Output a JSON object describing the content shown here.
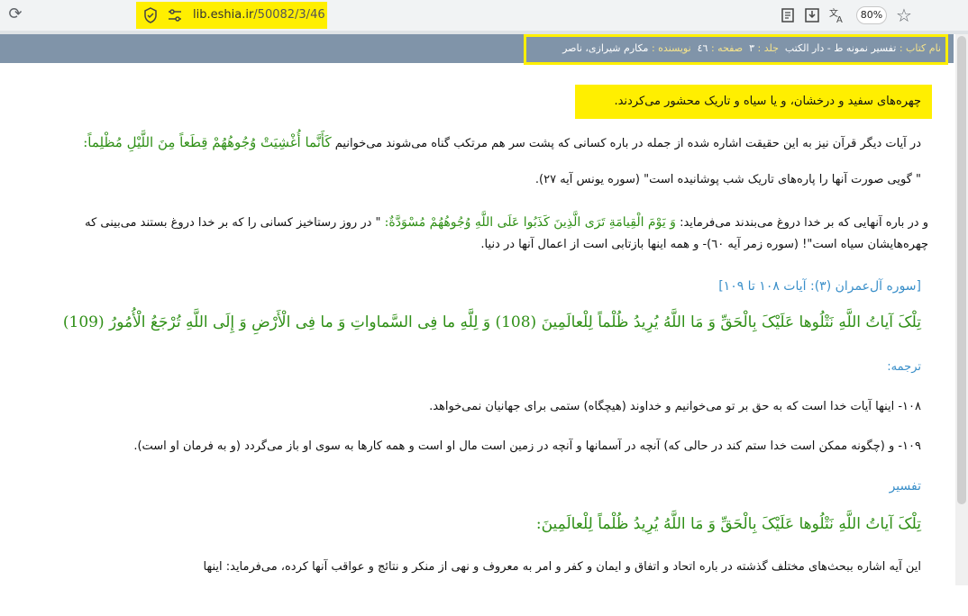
{
  "browser": {
    "url_domain": "lib.eshia.ir",
    "url_path": "/50082/3/46",
    "zoom": "80%"
  },
  "book": {
    "title_label": "نام کتاب :",
    "title_value": "تفسیر نمونه ط - دار الکتب",
    "volume_label": "جلد :",
    "volume_value": "۳",
    "page_label": "صفحه :",
    "page_value": "٤٦",
    "author_label": "نویسنده :",
    "author_value": "مکارم شیرازی، ناصر"
  },
  "content": {
    "highlight": "چهره‌های سفید و درخشان، و یا سیاه و تاریک محشور می‌کردند.",
    "p1_text": "در آیات دیگر قرآن نیز به این حقیقت اشاره شده از جمله در باره کسانى که پشت سر هم مرتکب گناه مى‌شوند مى‌خوانیم",
    "p1_verse": "کَأَنَّما أُغْشِیَتْ وُجُوهُهُمْ قِطَعاً مِنَ اللَّیْلِ مُظْلِماً:",
    "p2_text": "\" گویى صورت آنها را پاره‌هاى تاریک شب پوشانیده است\" (سوره یونس آیه ۲۷).",
    "p3_text_a": "و در باره آنهایى که بر خدا دروغ مى‌بندند مى‌فرماید:",
    "p3_verse": "وَ یَوْمَ الْقِیامَةِ تَرَى الَّذِینَ کَذَبُوا عَلَى اللَّهِ وُجُوهُهُمْ مُسْوَدَّةٌ:",
    "p3_text_b": "\" در روز رستاخیز کسانى را که بر خدا دروغ بستند مى‌بینى که",
    "p3_line2": "چهره‌هایشان سیاه است\"! (سوره زمر آیه ٦٠)- و همه اینها بازتابى است از اعمال آنها در دنیا.",
    "section_ref": "[سوره آل‌عمران (۳): آیات ۱۰۸ تا ۱۰۹]",
    "main_verse": "تِلْکَ آیاتُ اللَّهِ نَتْلُوها عَلَیْکَ بِالْحَقِّ وَ مَا اللَّهُ یُرِیدُ ظُلْماً لِلْعالَمِینَ (108) وَ لِلَّهِ ما فِی السَّماواتِ وَ ما فِی الْأَرْضِ وَ إِلَى اللَّهِ تُرْجَعُ الْأُمُورُ (109)",
    "translation_head": "ترجمه:",
    "tr_108": "۱۰۸- اینها آیات خدا است که به حق بر تو مى‌خوانیم و خداوند (هیچگاه) ستمى براى جهانیان نمى‌خواهد.",
    "tr_109": "۱۰۹- و (چگونه ممکن است خدا ستم کند در حالى که) آنچه در آسمانها و آنچه در زمین است مال او است و همه کارها به سوى او باز مى‌گردد (و به فرمان او است).",
    "tafsir_head": "تفسیر",
    "tafsir_verse": "تِلْکَ آیاتُ اللَّهِ نَتْلُوها عَلَیْکَ بِالْحَقِّ وَ مَا اللَّهُ یُرِیدُ ظُلْماً لِلْعالَمِینَ:",
    "last_para": "این آیه اشاره ببحث‌هاى مختلف گذشته در باره اتحاد و اتفاق و ایمان و کفر و امر به معروف و نهى از منکر و نتائج و عواقب آنها کرده، مى‌فرماید: اینها"
  },
  "colors": {
    "highlight": "#ffef00",
    "header": "#8094a9",
    "verse_green": "#2f8f16",
    "heading_blue": "#3a8fc9"
  },
  "icons": [
    "reload-icon",
    "shield-icon",
    "site-settings-icon",
    "reader-mode-icon",
    "download-icon",
    "translate-icon",
    "star-icon"
  ]
}
